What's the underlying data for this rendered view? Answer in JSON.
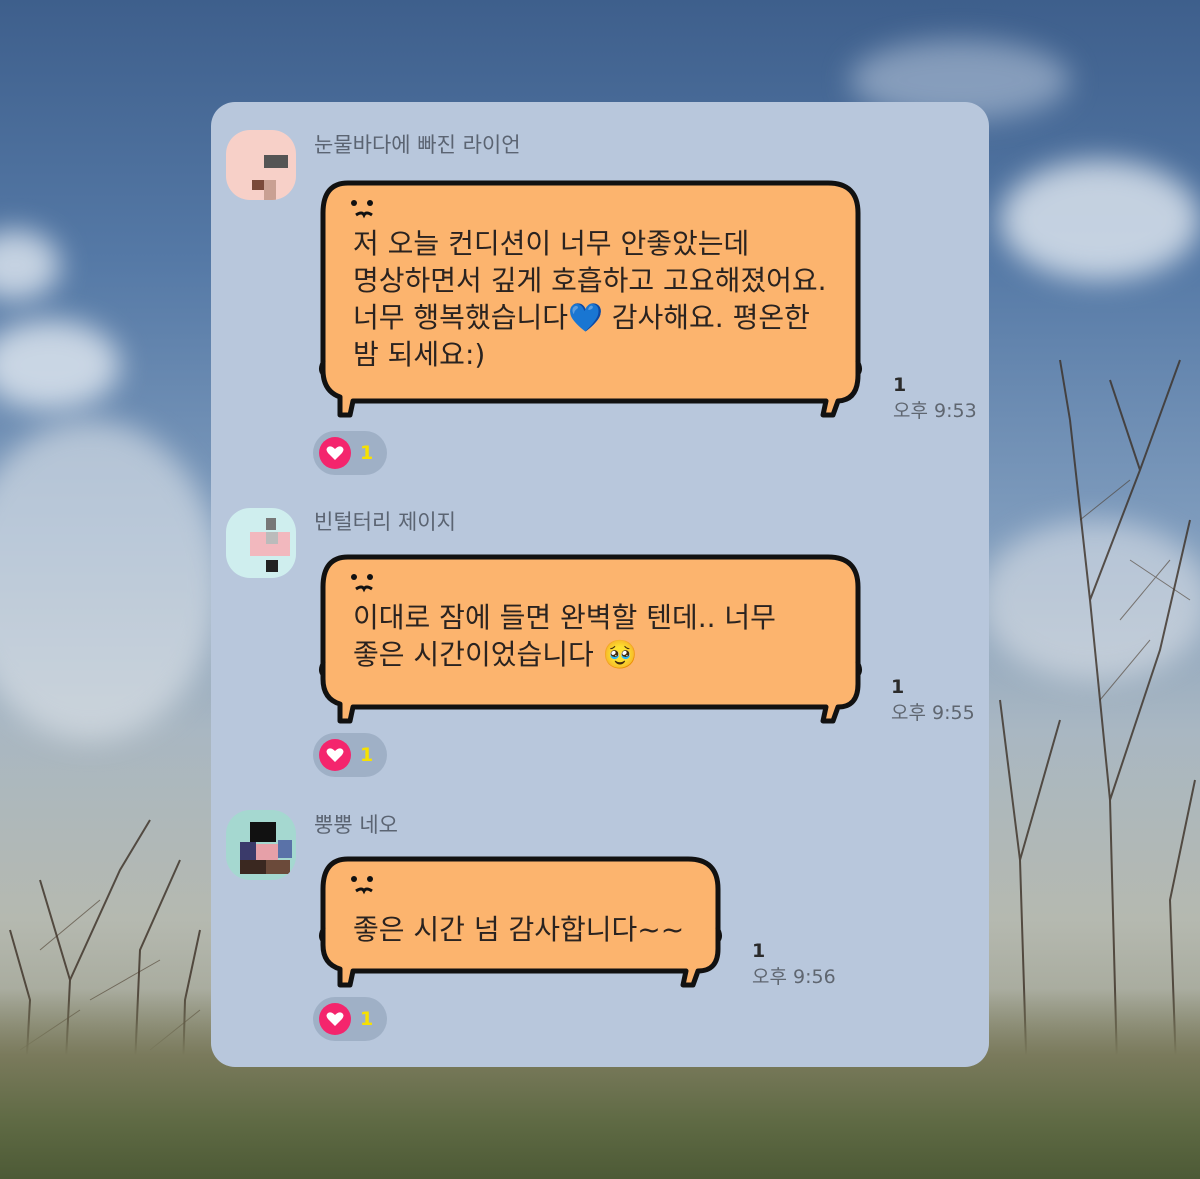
{
  "colors": {
    "card_bg": "#b8c7dc",
    "bubble_fill": "#fcb46e",
    "bubble_outline": "#111111",
    "reaction_heart": "#f4256d",
    "reaction_count": "#f7e100"
  },
  "messages": [
    {
      "sender": "눈물바다에 빠진 라이언",
      "text": "저 오늘 컨디션이 너무 안좋았는데 명상하면서 깊게 호흡하고 고요해졌어요. 너무 행복했습니다💙 감사해요. 평온한 밤 되세요:)",
      "unread": "1",
      "time": "오후 9:53",
      "reaction_icon": "heart-icon",
      "reaction_count": "1"
    },
    {
      "sender": "빈털터리 제이지",
      "text": "이대로 잠에 들면 완벽할 텐데.. 너무 좋은 시간이었습니다 🥹",
      "unread": "1",
      "time": "오후 9:55",
      "reaction_icon": "heart-icon",
      "reaction_count": "1"
    },
    {
      "sender": "뿡뿡 네오",
      "text": "좋은 시간 넘 감사합니다~~",
      "unread": "1",
      "time": "오후 9:56",
      "reaction_icon": "heart-icon",
      "reaction_count": "1"
    }
  ]
}
